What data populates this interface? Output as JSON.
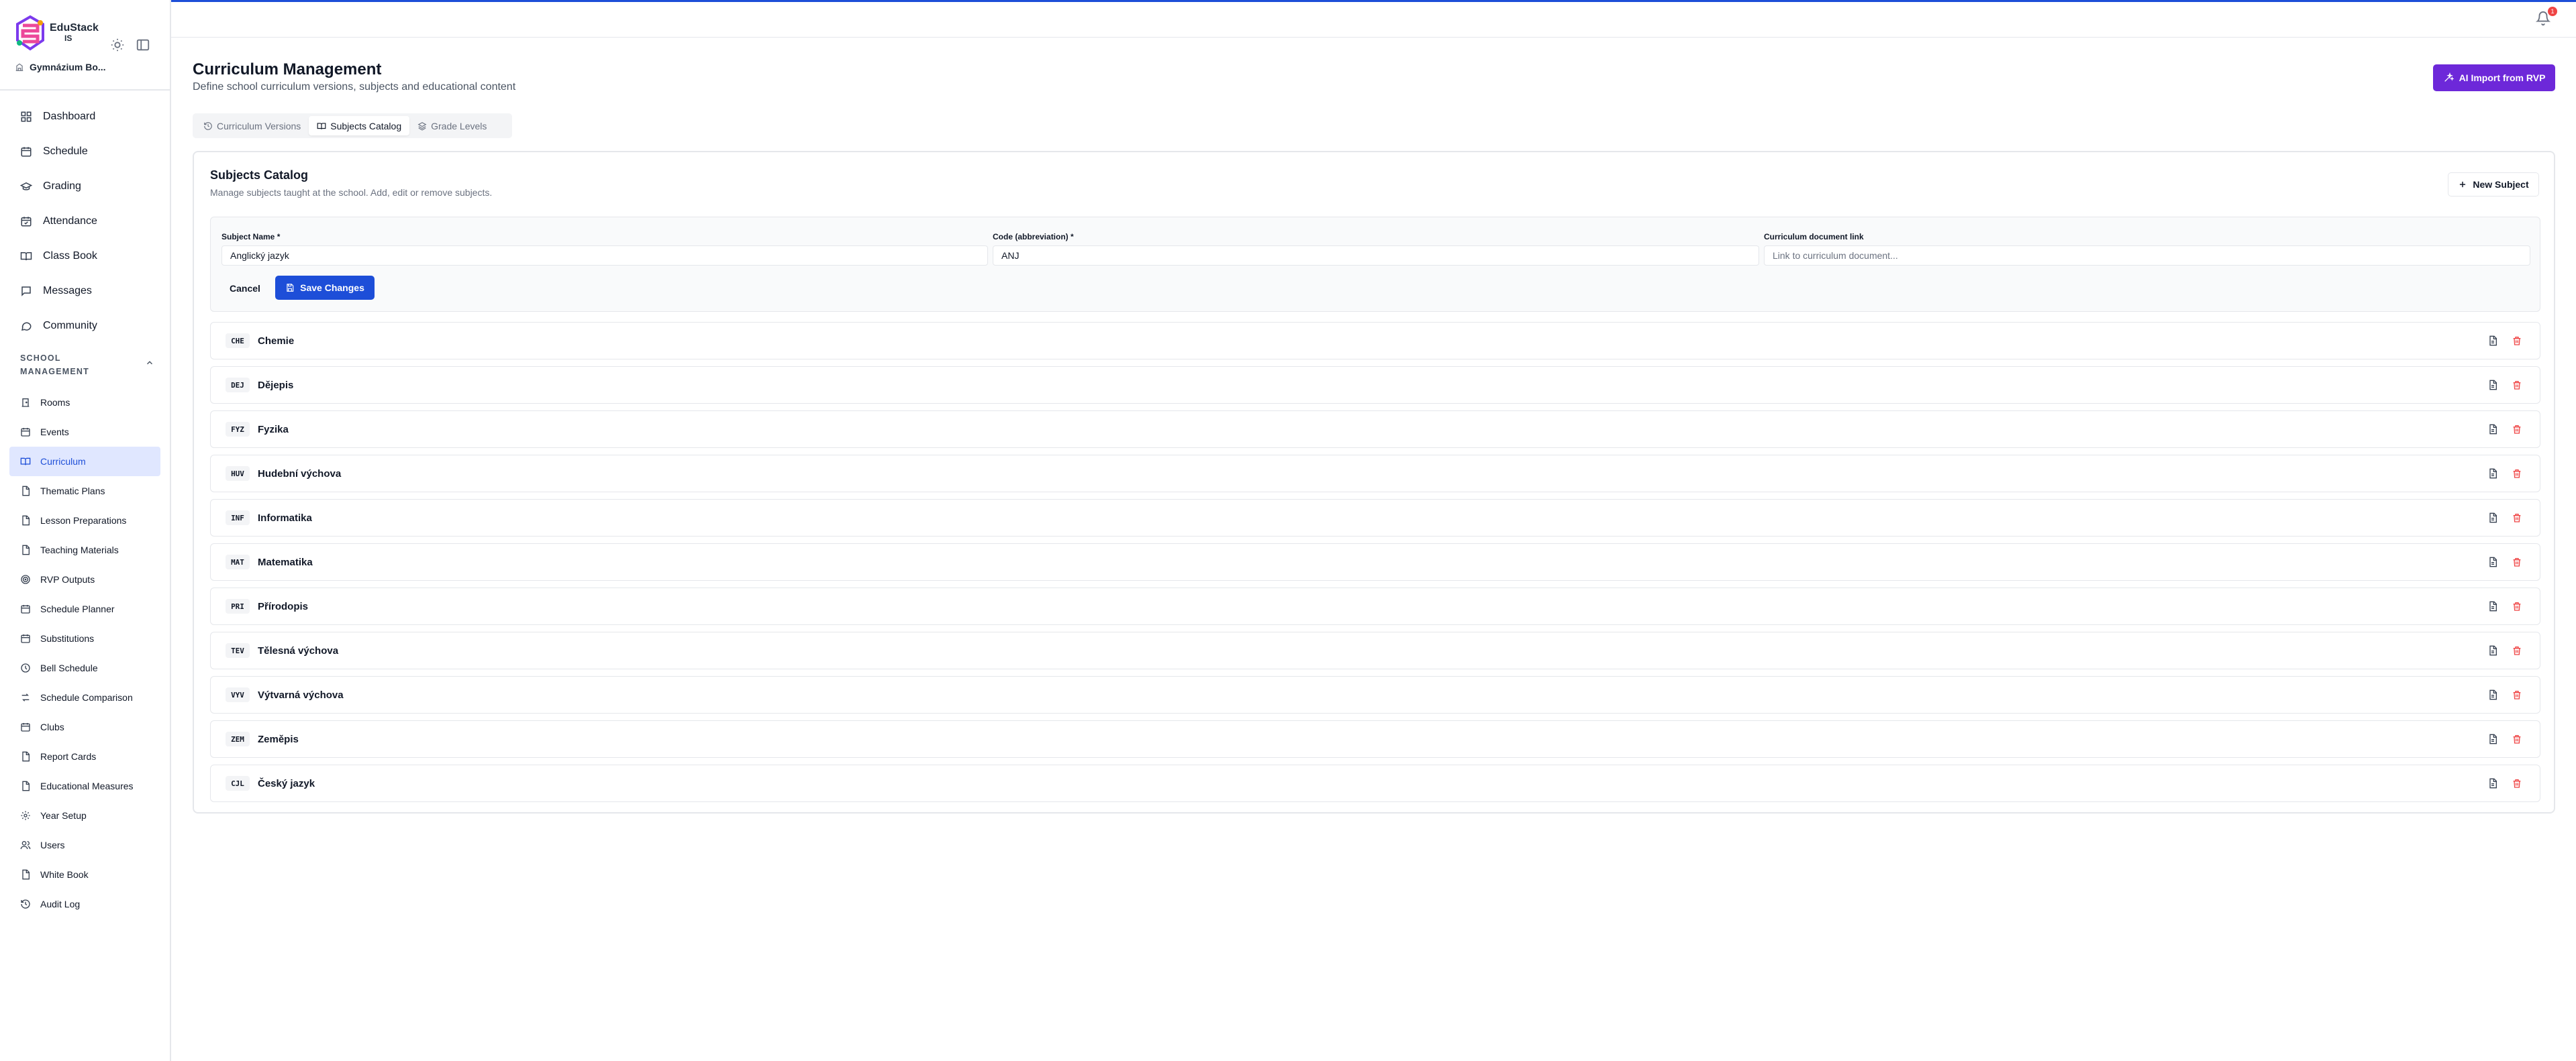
{
  "app": {
    "logo_line1": "EduStack",
    "logo_line2": "IS",
    "school_name": "Gymnázium Bo..."
  },
  "nav_main": [
    {
      "label": "Dashboard",
      "icon": "dashboard-icon"
    },
    {
      "label": "Schedule",
      "icon": "calendar-icon"
    },
    {
      "label": "Grading",
      "icon": "graduation-cap-icon"
    },
    {
      "label": "Attendance",
      "icon": "calendar-check-icon"
    },
    {
      "label": "Class Book",
      "icon": "book-open-icon"
    },
    {
      "label": "Messages",
      "icon": "message-icon"
    },
    {
      "label": "Community",
      "icon": "chat-icon"
    }
  ],
  "section": {
    "label_line1": "SCHOOL",
    "label_line2": "MANAGEMENT"
  },
  "nav_sub": [
    {
      "label": "Rooms",
      "icon": "door-icon"
    },
    {
      "label": "Events",
      "icon": "calendar-icon"
    },
    {
      "label": "Curriculum",
      "icon": "book-open-icon",
      "active": true
    },
    {
      "label": "Thematic Plans",
      "icon": "file-icon"
    },
    {
      "label": "Lesson Preparations",
      "icon": "file-icon"
    },
    {
      "label": "Teaching Materials",
      "icon": "file-icon"
    },
    {
      "label": "RVP Outputs",
      "icon": "target-icon"
    },
    {
      "label": "Schedule Planner",
      "icon": "calendar-icon"
    },
    {
      "label": "Substitutions",
      "icon": "calendar-icon"
    },
    {
      "label": "Bell Schedule",
      "icon": "clock-icon"
    },
    {
      "label": "Schedule Comparison",
      "icon": "compare-icon"
    },
    {
      "label": "Clubs",
      "icon": "calendar-icon"
    },
    {
      "label": "Report Cards",
      "icon": "file-icon"
    },
    {
      "label": "Educational Measures",
      "icon": "file-icon"
    },
    {
      "label": "Year Setup",
      "icon": "gear-icon"
    },
    {
      "label": "Users",
      "icon": "users-icon"
    },
    {
      "label": "White Book",
      "icon": "file-icon"
    },
    {
      "label": "Audit Log",
      "icon": "history-icon"
    }
  ],
  "header": {
    "notification_count": "1"
  },
  "page": {
    "title": "Curriculum Management",
    "subtitle": "Define school curriculum versions, subjects and educational content",
    "ai_button": "AI Import from RVP"
  },
  "tabs": [
    {
      "label": "Curriculum Versions",
      "icon": "history-icon"
    },
    {
      "label": "Subjects Catalog",
      "icon": "book-open-icon",
      "active": true
    },
    {
      "label": "Grade Levels",
      "icon": "layers-icon"
    }
  ],
  "catalog": {
    "title": "Subjects Catalog",
    "subtitle": "Manage subjects taught at the school. Add, edit or remove subjects.",
    "new_button": "New Subject"
  },
  "form": {
    "name_label": "Subject Name *",
    "name_value": "Anglický jazyk",
    "code_label": "Code (abbreviation) *",
    "code_value": "ANJ",
    "link_label": "Curriculum document link",
    "link_placeholder": "Link to curriculum document...",
    "cancel": "Cancel",
    "save": "Save Changes"
  },
  "subjects": [
    {
      "code": "CHE",
      "name": "Chemie"
    },
    {
      "code": "DEJ",
      "name": "Dějepis"
    },
    {
      "code": "FYZ",
      "name": "Fyzika"
    },
    {
      "code": "HUV",
      "name": "Hudební výchova"
    },
    {
      "code": "INF",
      "name": "Informatika"
    },
    {
      "code": "MAT",
      "name": "Matematika"
    },
    {
      "code": "PRI",
      "name": "Přírodopis"
    },
    {
      "code": "TEV",
      "name": "Tělesná výchova"
    },
    {
      "code": "VYV",
      "name": "Výtvarná výchova"
    },
    {
      "code": "ZEM",
      "name": "Zeměpis"
    },
    {
      "code": "CJL",
      "name": "Český jazyk"
    }
  ],
  "colors": {
    "primary": "#1d4ed8",
    "ai_purple": "#6d28d9",
    "danger": "#ef4444",
    "active_bg": "#e0e7ff"
  }
}
